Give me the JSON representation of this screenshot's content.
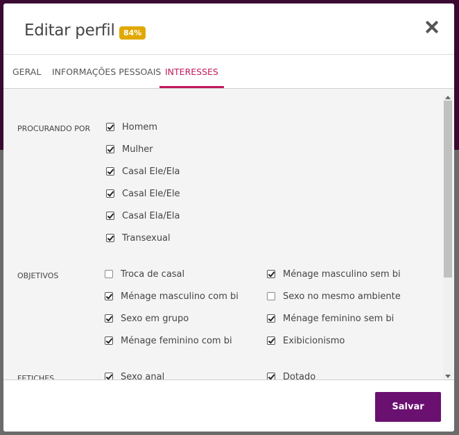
{
  "modal": {
    "title": "Editar perfil",
    "badge": "84%"
  },
  "tabs": [
    {
      "label": "GERAL",
      "active": false
    },
    {
      "label": "INFORMAÇÕES PESSOAIS",
      "active": false
    },
    {
      "label": "INTERESSES",
      "active": true
    }
  ],
  "sections": {
    "procurando": {
      "label": "PROCURANDO POR",
      "options": [
        {
          "label": "Homem",
          "checked": true
        },
        {
          "label": "Mulher",
          "checked": true
        },
        {
          "label": "Casal Ele/Ela",
          "checked": true
        },
        {
          "label": "Casal Ele/Ele",
          "checked": true
        },
        {
          "label": "Casal Ela/Ela",
          "checked": true
        },
        {
          "label": "Transexual",
          "checked": true
        }
      ]
    },
    "objetivos": {
      "label": "OBJETIVOS",
      "options": [
        {
          "label": "Troca de casal",
          "checked": false
        },
        {
          "label": "Ménage masculino sem bi",
          "checked": true
        },
        {
          "label": "Ménage masculino com bi",
          "checked": true
        },
        {
          "label": "Sexo no mesmo ambiente",
          "checked": false
        },
        {
          "label": "Sexo em grupo",
          "checked": true
        },
        {
          "label": "Ménage feminino sem bi",
          "checked": true
        },
        {
          "label": "Ménage feminino com bi",
          "checked": true
        },
        {
          "label": "Exibicionismo",
          "checked": true
        }
      ]
    },
    "fetiches": {
      "label": "FETICHES",
      "options": [
        {
          "label": "Sexo anal",
          "checked": true
        },
        {
          "label": "Dotado",
          "checked": true
        }
      ]
    }
  },
  "footer": {
    "save_label": "Salvar"
  },
  "colors": {
    "accent": "#c2185b",
    "primary_button": "#6a1070",
    "badge": "#e0a800"
  }
}
